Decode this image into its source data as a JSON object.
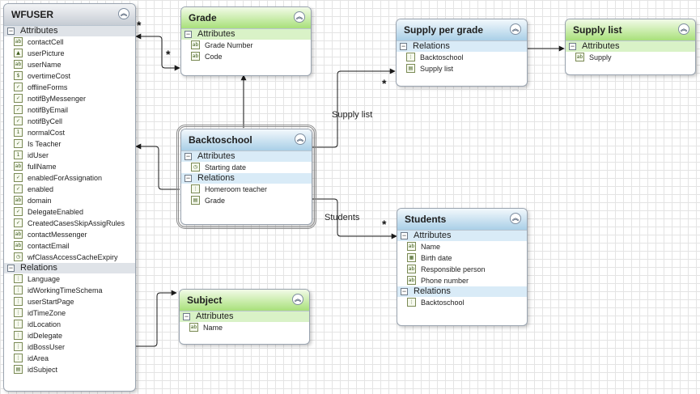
{
  "entities": [
    {
      "id": "wfuser",
      "title": "WFUSER",
      "theme": "gray",
      "sections": [
        {
          "label": "Attributes",
          "items": [
            {
              "name": "contactCell",
              "icon": "text-icon"
            },
            {
              "name": "userPicture",
              "icon": "picture-icon"
            },
            {
              "name": "userName",
              "icon": "text-icon"
            },
            {
              "name": "overtimeCost",
              "icon": "currency-icon"
            },
            {
              "name": "offlineForms",
              "icon": "checkbox-icon"
            },
            {
              "name": "notifByMessenger",
              "icon": "checkbox-icon"
            },
            {
              "name": "notifByEmail",
              "icon": "checkbox-icon"
            },
            {
              "name": "notifByCell",
              "icon": "checkbox-icon"
            },
            {
              "name": "normalCost",
              "icon": "number-icon"
            },
            {
              "name": "Is Teacher",
              "icon": "checkbox-icon"
            },
            {
              "name": "idUser",
              "icon": "number-icon"
            },
            {
              "name": "fullName",
              "icon": "text-icon"
            },
            {
              "name": "enabledForAssignation",
              "icon": "checkbox-icon"
            },
            {
              "name": "enabled",
              "icon": "checkbox-icon"
            },
            {
              "name": "domain",
              "icon": "text-icon"
            },
            {
              "name": "DelegateEnabled",
              "icon": "checkbox-icon"
            },
            {
              "name": "CreatedCasesSkipAssigRules",
              "icon": "checkbox-icon"
            },
            {
              "name": "contactMessenger",
              "icon": "text-icon"
            },
            {
              "name": "contactEmail",
              "icon": "text-icon"
            },
            {
              "name": "wfClassAccessCacheExpiry",
              "icon": "datetime-icon"
            }
          ]
        },
        {
          "label": "Relations",
          "items": [
            {
              "name": "Language",
              "icon": "relation-icon"
            },
            {
              "name": "idWorkingTimeSchema",
              "icon": "relation-icon"
            },
            {
              "name": "userStartPage",
              "icon": "relation-icon"
            },
            {
              "name": "idTimeZone",
              "icon": "relation-icon"
            },
            {
              "name": "idLocation",
              "icon": "relation-icon"
            },
            {
              "name": "idDelegate",
              "icon": "relation-icon"
            },
            {
              "name": "idBossUser",
              "icon": "relation-icon"
            },
            {
              "name": "idArea",
              "icon": "relation-icon"
            },
            {
              "name": "idSubject",
              "icon": "table-icon"
            }
          ]
        }
      ]
    },
    {
      "id": "grade",
      "title": "Grade",
      "theme": "green",
      "sections": [
        {
          "label": "Attributes",
          "items": [
            {
              "name": "Grade Number",
              "icon": "text-icon"
            },
            {
              "name": "Code",
              "icon": "text-icon"
            }
          ]
        }
      ]
    },
    {
      "id": "supply-per-grade",
      "title": "Supply per grade",
      "theme": "blue",
      "sections": [
        {
          "label": "Relations",
          "items": [
            {
              "name": "Backtoschool",
              "icon": "relation-icon"
            },
            {
              "name": "Supply list",
              "icon": "table-icon"
            }
          ]
        }
      ]
    },
    {
      "id": "supply-list",
      "title": "Supply list",
      "theme": "green",
      "sections": [
        {
          "label": "Attributes",
          "items": [
            {
              "name": "Supply",
              "icon": "text-icon"
            }
          ]
        }
      ]
    },
    {
      "id": "backtoschool",
      "title": "Backtoschool",
      "theme": "blue",
      "sections": [
        {
          "label": "Attributes",
          "items": [
            {
              "name": "Starting date",
              "icon": "datetime-icon"
            }
          ]
        },
        {
          "label": "Relations",
          "items": [
            {
              "name": "Homeroom teacher",
              "icon": "relation-icon"
            },
            {
              "name": "Grade",
              "icon": "table-icon"
            }
          ]
        }
      ]
    },
    {
      "id": "students",
      "title": "Students",
      "theme": "blue",
      "sections": [
        {
          "label": "Attributes",
          "items": [
            {
              "name": "Name",
              "icon": "text-icon"
            },
            {
              "name": "Birth date",
              "icon": "date-icon"
            },
            {
              "name": "Responsible person",
              "icon": "text-icon"
            },
            {
              "name": "Phone number",
              "icon": "text-icon"
            }
          ]
        },
        {
          "label": "Relations",
          "items": [
            {
              "name": "Backtoschool",
              "icon": "relation-icon"
            }
          ]
        }
      ]
    },
    {
      "id": "subject",
      "title": "Subject",
      "theme": "green",
      "sections": [
        {
          "label": "Attributes",
          "items": [
            {
              "name": "Name",
              "icon": "text-icon"
            }
          ]
        }
      ]
    }
  ],
  "links": [
    {
      "id": "supply-list-link",
      "label": "Supply list"
    },
    {
      "id": "students-link",
      "label": "Students"
    }
  ],
  "multiplicity": "*",
  "collapse_glyph": "︽",
  "toggle_glyph": "−",
  "icon_glyphs": {
    "text-icon": "ab",
    "picture-icon": "▲",
    "currency-icon": "$",
    "checkbox-icon": "✓",
    "number-icon": "1",
    "datetime-icon": "◷",
    "date-icon": "▦",
    "relation-icon": "⋮",
    "table-icon": "▤"
  },
  "colors": {
    "gray_header": "#c6ccd4",
    "green_header": "#a8e07a",
    "blue_header": "#a9cfe7",
    "connector": "#1a1a1a"
  }
}
